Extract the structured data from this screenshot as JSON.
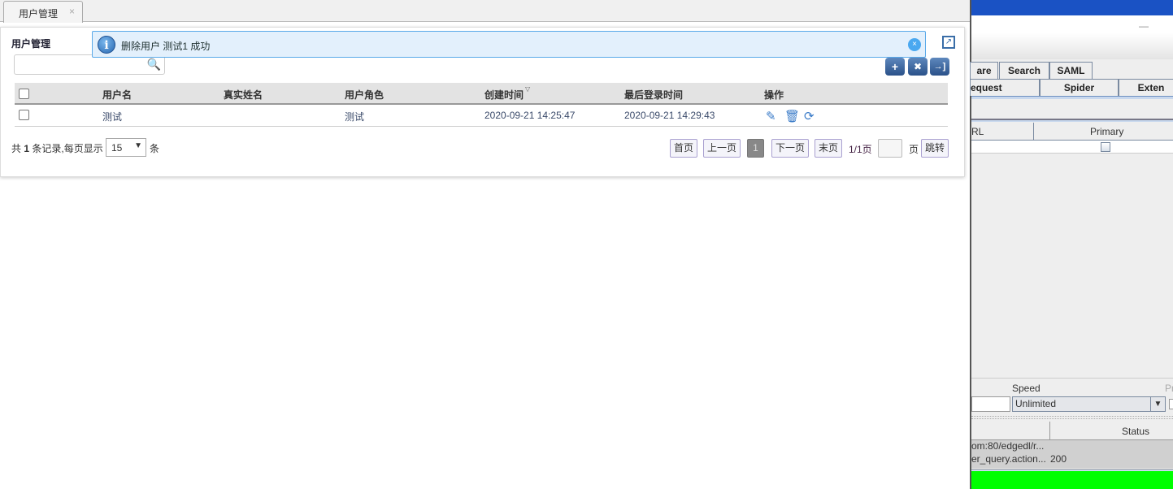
{
  "browser_tab": {
    "label": "用户管理",
    "close": "×"
  },
  "panel": {
    "title": "用户管理",
    "search": {
      "value": "",
      "placeholder": ""
    },
    "message": {
      "text": "删除用户 测试1 成功",
      "close": "×"
    },
    "toolbar": {
      "add": "+",
      "delete": "✖",
      "export": "→]"
    },
    "columns": [
      "用户名",
      "真实姓名",
      "用户角色",
      "创建时间",
      "最后登录时间",
      "操作"
    ],
    "sort_indicator": "▽",
    "rows": [
      {
        "username": "测试",
        "realname": "",
        "role": "测试",
        "created": "2020-09-21 14:25:47",
        "last_login": "2020-09-21 14:29:43"
      }
    ],
    "footer": {
      "prefix": "共",
      "count": "1",
      "mid": "条记录,每页显示",
      "page_size": "15",
      "suffix": "条"
    },
    "pagination": {
      "first": "首页",
      "prev": "上一页",
      "current": "1",
      "next": "下一页",
      "last": "末页",
      "info": "1/1页",
      "page_input": "",
      "page_label": "页",
      "jump": "跳转"
    }
  },
  "java_app": {
    "minimize": "—",
    "tabs_row1": [
      "are",
      "Search",
      "SAML"
    ],
    "tabs_row2": [
      "equest",
      "Spider",
      "Exten"
    ],
    "table1": {
      "columns": [
        "RL",
        "Primary"
      ]
    },
    "speed_label": "Speed",
    "speed_value": "Unlimited",
    "partial_label": "Pr",
    "table2": {
      "columns": [
        "",
        "Status"
      ],
      "rows": [
        [
          "om:80/edgedl/r...",
          ""
        ],
        [
          "er_query.action...",
          "200"
        ]
      ]
    },
    "colors": {
      "titlebar": "#1a52c4",
      "progress": "#00ff00"
    }
  }
}
